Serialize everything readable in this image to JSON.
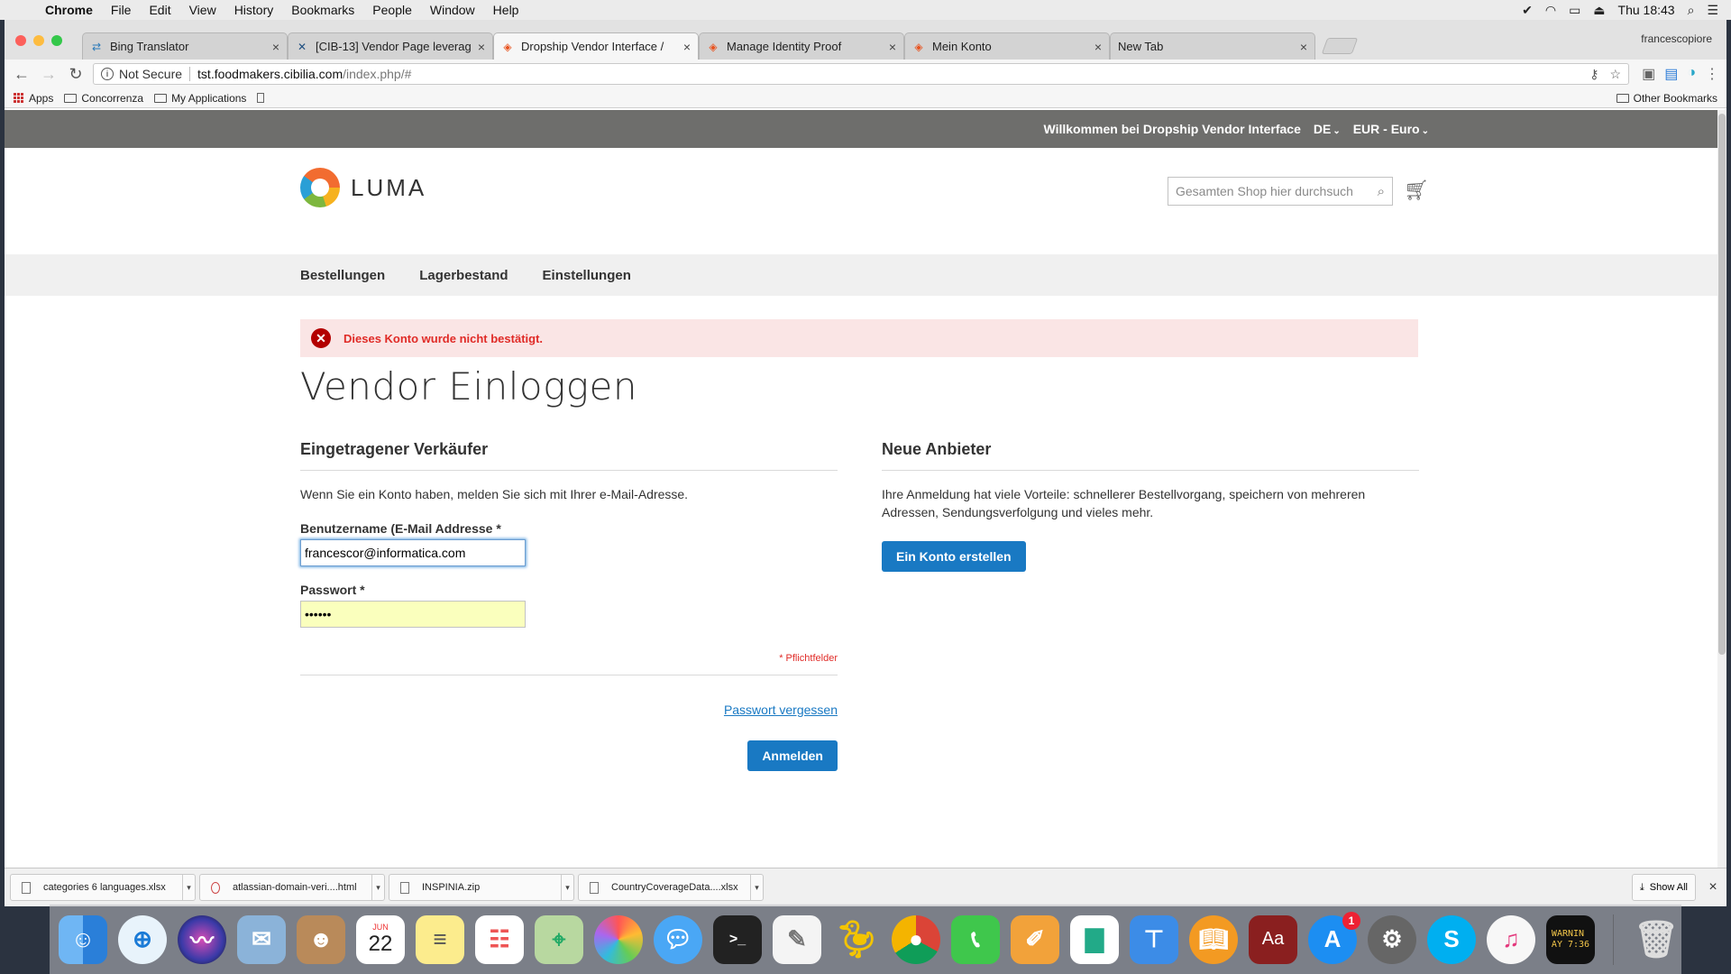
{
  "menubar": {
    "app": "Chrome",
    "items": [
      "File",
      "Edit",
      "View",
      "History",
      "Bookmarks",
      "People",
      "Window",
      "Help"
    ],
    "clock": "Thu 18:43"
  },
  "browser": {
    "profile": "francescopiore",
    "tabs": [
      {
        "title": "Bing Translator",
        "icon": "bing-translator-icon",
        "active": false
      },
      {
        "title": "[CIB-13] Vendor Page leverag",
        "icon": "jira-icon",
        "active": false
      },
      {
        "title": "Dropship Vendor Interface /",
        "icon": "magento-icon",
        "active": true
      },
      {
        "title": "Manage Identity Proof",
        "icon": "magento-icon",
        "active": false
      },
      {
        "title": "Mein Konto",
        "icon": "magento-icon",
        "active": false
      },
      {
        "title": "New Tab",
        "icon": "",
        "active": false
      }
    ],
    "address": {
      "security": "Not Secure",
      "host": "tst.foodmakers.cibilia.com",
      "path": "/index.php/#"
    },
    "bookmarks": [
      "Apps",
      "Concorrenza",
      "My Applications"
    ],
    "other_bookmarks": "Other Bookmarks"
  },
  "page": {
    "welcome": "Willkommen bei Dropship Vendor Interface",
    "language": "DE",
    "currency": "EUR - Euro",
    "logo_text": "LUMA",
    "search_placeholder": "Gesamten Shop hier durchsuch",
    "nav": [
      "Bestellungen",
      "Lagerbestand",
      "Einstellungen"
    ],
    "alert": "Dieses Konto wurde nicht bestätigt.",
    "title": "Vendor Einloggen",
    "login": {
      "heading": "Eingetragener Verkäufer",
      "intro": "Wenn Sie ein Konto haben, melden Sie sich mit Ihrer e-Mail-Adresse.",
      "username_label": "Benutzername (E-Mail Addresse *",
      "username_value": "francescor@informatica.com",
      "password_label": "Passwort *",
      "password_value": "••••••",
      "required_note": "* Pflichtfelder",
      "forgot": "Passwort vergessen",
      "submit": "Anmelden"
    },
    "register": {
      "heading": "Neue Anbieter",
      "intro": "Ihre Anmeldung hat viele Vorteile: schnellerer Bestellvorgang, speichern von mehreren Adressen, Sendungsverfolgung und vieles mehr.",
      "button": "Ein Konto erstellen"
    }
  },
  "downloads": {
    "items": [
      "categories 6 languages.xlsx",
      "atlassian-domain-veri....html",
      "INSPINIA.zip",
      "CountryCoverageData....xlsx"
    ],
    "show_all": "Show All"
  },
  "dock": {
    "calendar_month": "JUN",
    "calendar_day": "22",
    "appstore_badge": "1",
    "console_text": "WARNIN\nAY 7:36"
  }
}
